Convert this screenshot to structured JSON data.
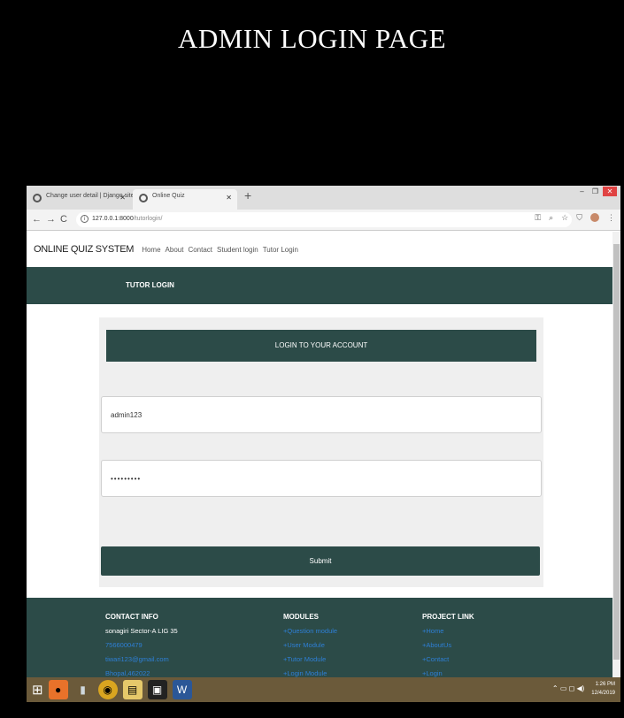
{
  "slide_title": "ADMIN LOGIN PAGE",
  "browser": {
    "tabs": [
      {
        "label": "Change user detail | Django site",
        "active": false
      },
      {
        "label": "Online Quiz",
        "active": true
      }
    ],
    "window_controls": {
      "minimize": "–",
      "restore": "❐",
      "close": "✕"
    },
    "url_host": "127.0.0.1:8000",
    "url_path": "/tutorlogin/"
  },
  "site": {
    "brand": "ONLINE QUIZ SYSTEM",
    "nav": [
      "Home",
      "About",
      "Contact",
      "Student login",
      "Tutor Login"
    ],
    "banner_title": "TUTOR LOGIN"
  },
  "login": {
    "heading": "LOGIN TO YOUR ACCOUNT",
    "username_value": "admin123",
    "password_value": "•••••••••",
    "submit_label": "Submit"
  },
  "footer": {
    "contact": {
      "heading": "CONTACT INFO",
      "address": "sonagiri Sector-A LIG 35",
      "phone": "7566000479",
      "email": "tiwari123@gmail.com",
      "location": "Bhopal,462022"
    },
    "modules": {
      "heading": "MODULES",
      "items": [
        "+Question module",
        "+User Module",
        "+Tutor Module",
        "+Login Module"
      ]
    },
    "project": {
      "heading": "PROJECT LINK",
      "items": [
        "+Home",
        "+AboutUs",
        "+Contact",
        "+Login"
      ]
    }
  },
  "taskbar": {
    "time": "1:26 PM",
    "date": "12/4/2019"
  },
  "colors": {
    "theme": "#2c4b48",
    "link": "#2e7fd6"
  }
}
